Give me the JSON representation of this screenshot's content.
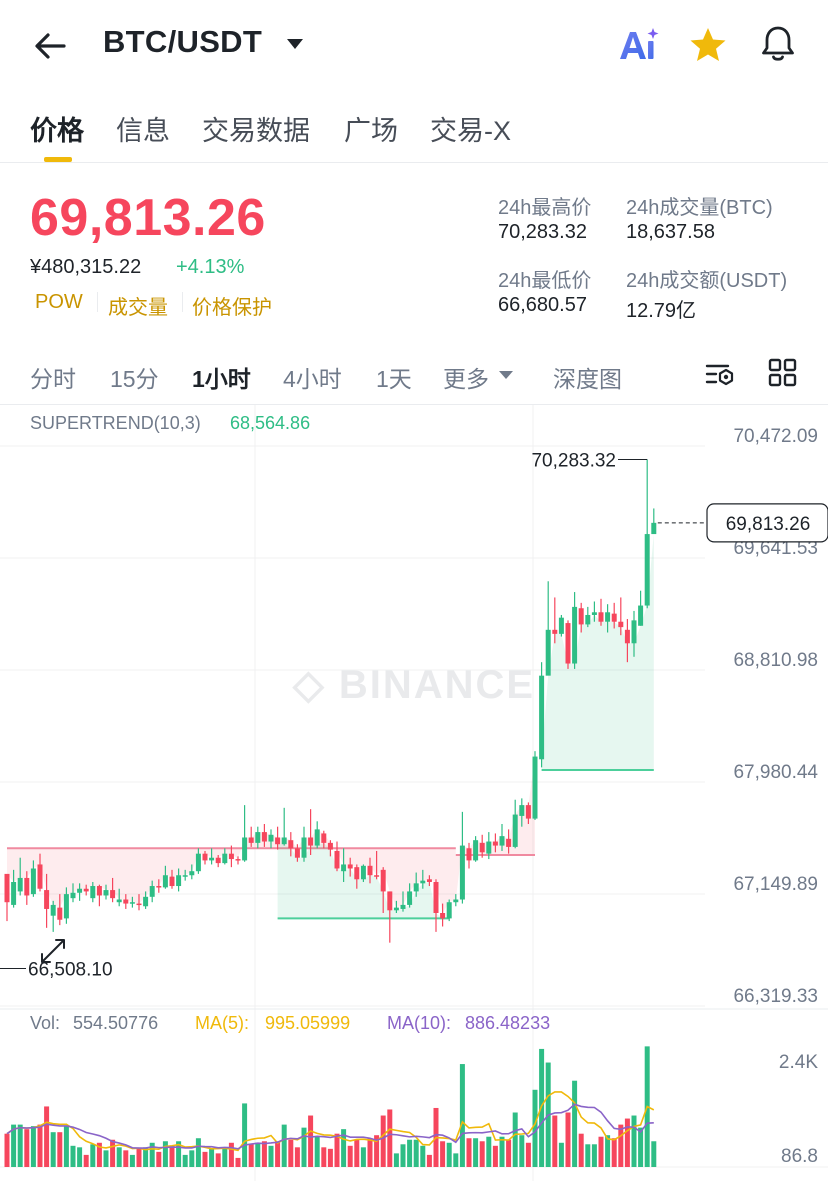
{
  "header": {
    "pair": "BTC/USDT",
    "icons": [
      "back-arrow-icon",
      "caret-down-icon",
      "ai-icon",
      "star-icon",
      "bell-icon"
    ]
  },
  "tabs": [
    "价格",
    "信息",
    "交易数据",
    "广场",
    "交易-X"
  ],
  "active_tab": "价格",
  "price": {
    "last": "69,813.26",
    "cny": "¥480,315.22",
    "change": "+4.13%",
    "tags": [
      "POW",
      "成交量",
      "价格保护"
    ]
  },
  "stats": {
    "high_label": "24h最高价",
    "high_value": "70,283.32",
    "vol_btc_label": "24h成交量(BTC)",
    "vol_btc_value": "18,637.58",
    "low_label": "24h最低价",
    "low_value": "66,680.57",
    "vol_usdt_label": "24h成交额(USDT)",
    "vol_usdt_value": "12.79亿"
  },
  "intervals": {
    "items": [
      "分时",
      "15分",
      "1小时",
      "4小时",
      "1天",
      "更多",
      "深度图"
    ],
    "active": "1小时"
  },
  "indicator": {
    "supertrend_label": "SUPERTREND(10,3)",
    "supertrend_value": "68,564.86"
  },
  "colors": {
    "up": "#2ebd85",
    "down": "#f6465d",
    "accent": "#f0b90b",
    "tag": "#c99400",
    "ma5": "#f0b90b",
    "ma10": "#8a64c8"
  },
  "chart_data": {
    "type": "candlestick",
    "watermark": "BINANCE",
    "y_ticks": [
      "70,472.09",
      "69,641.53",
      "68,810.98",
      "67,980.44",
      "67,149.89",
      "66,319.33"
    ],
    "ylim": [
      66319.33,
      70472.09
    ],
    "high_marker": "70,283.32",
    "low_marker": "66,508.10",
    "last_price_label": "69,813.26",
    "candles": [
      [
        67210,
        67000,
        66860,
        67080
      ],
      [
        66980,
        67150,
        66960,
        67240
      ],
      [
        67080,
        67180,
        67050,
        67330
      ],
      [
        67180,
        67050,
        66980,
        67230
      ],
      [
        67060,
        67250,
        67040,
        67310
      ],
      [
        67280,
        67100,
        67080,
        67360
      ],
      [
        67090,
        66950,
        66810,
        67210
      ],
      [
        66900,
        66980,
        66780,
        67010
      ],
      [
        66960,
        66870,
        66830,
        67060
      ],
      [
        66880,
        67060,
        66840,
        67110
      ],
      [
        67030,
        67070,
        67000,
        67140
      ],
      [
        67070,
        67100,
        67010,
        67140
      ],
      [
        67100,
        67080,
        67050,
        67130
      ],
      [
        67030,
        67120,
        67000,
        67150
      ],
      [
        67120,
        67050,
        66970,
        67130
      ],
      [
        67050,
        67090,
        67020,
        67130
      ],
      [
        67090,
        67030,
        67000,
        67180
      ],
      [
        67000,
        67020,
        66970,
        67100
      ],
      [
        67020,
        66990,
        66950,
        67060
      ],
      [
        66990,
        67000,
        66960,
        67040
      ],
      [
        66990,
        66980,
        66940,
        67060
      ],
      [
        66970,
        67040,
        66950,
        67080
      ],
      [
        67040,
        67120,
        67000,
        67160
      ],
      [
        67120,
        67110,
        67070,
        67170
      ],
      [
        67110,
        67200,
        67100,
        67270
      ],
      [
        67190,
        67120,
        67100,
        67240
      ],
      [
        67120,
        67200,
        67080,
        67250
      ],
      [
        67200,
        67200,
        67160,
        67240
      ],
      [
        67200,
        67230,
        67170,
        67280
      ],
      [
        67230,
        67360,
        67210,
        67400
      ],
      [
        67360,
        67310,
        67280,
        67380
      ],
      [
        67310,
        67330,
        67280,
        67400
      ],
      [
        67330,
        67290,
        67260,
        67350
      ],
      [
        67290,
        67360,
        67280,
        67400
      ],
      [
        67360,
        67320,
        67260,
        67420
      ],
      [
        67320,
        67310,
        67280,
        67340
      ],
      [
        67310,
        67480,
        67300,
        67720
      ],
      [
        67480,
        67440,
        67410,
        67560
      ],
      [
        67440,
        67520,
        67400,
        67560
      ],
      [
        67520,
        67450,
        67410,
        67580
      ],
      [
        67450,
        67500,
        67400,
        67540
      ],
      [
        67480,
        67430,
        67390,
        67560
      ],
      [
        67430,
        67480,
        67420,
        67700
      ],
      [
        67460,
        67400,
        67340,
        67520
      ],
      [
        67400,
        67330,
        67300,
        67430
      ],
      [
        67330,
        67480,
        67300,
        67560
      ],
      [
        67480,
        67420,
        67350,
        67690
      ],
      [
        67420,
        67540,
        67400,
        67600
      ],
      [
        67510,
        67440,
        67400,
        67530
      ],
      [
        67440,
        67390,
        67340,
        67460
      ],
      [
        67380,
        67250,
        67230,
        67450
      ],
      [
        67230,
        67280,
        67150,
        67400
      ],
      [
        67280,
        67250,
        67190,
        67330
      ],
      [
        67260,
        67170,
        67100,
        67280
      ],
      [
        67170,
        67270,
        67150,
        67280
      ],
      [
        67270,
        67200,
        67140,
        67330
      ],
      [
        67200,
        67190,
        67170,
        67380
      ],
      [
        67240,
        67080,
        66920,
        67260
      ],
      [
        67080,
        66940,
        66700,
        67080
      ],
      [
        66940,
        66960,
        66920,
        67010
      ],
      [
        66950,
        66980,
        66930,
        67080
      ],
      [
        66980,
        67080,
        66960,
        67140
      ],
      [
        67080,
        67140,
        67040,
        67220
      ],
      [
        67140,
        67160,
        67100,
        67240
      ],
      [
        67170,
        67150,
        67120,
        67200
      ],
      [
        67150,
        66920,
        66780,
        67170
      ],
      [
        66920,
        66880,
        66820,
        66990
      ],
      [
        66880,
        67000,
        66860,
        67020
      ],
      [
        67000,
        67020,
        66970,
        67060
      ],
      [
        67020,
        67420,
        66990,
        67670
      ],
      [
        67400,
        67310,
        67250,
        67440
      ],
      [
        67310,
        67460,
        67300,
        67490
      ],
      [
        67440,
        67370,
        67330,
        67500
      ],
      [
        67360,
        67450,
        67320,
        67520
      ],
      [
        67450,
        67420,
        67370,
        67510
      ],
      [
        67420,
        67490,
        67380,
        67580
      ],
      [
        67470,
        67410,
        67360,
        67540
      ],
      [
        67410,
        67650,
        67400,
        67760
      ],
      [
        67640,
        67720,
        67560,
        67770
      ],
      [
        67720,
        67620,
        67580,
        67740
      ],
      [
        67620,
        68080,
        67610,
        68120
      ],
      [
        68060,
        68680,
        68000,
        68780
      ],
      [
        68680,
        69020,
        68690,
        69380
      ],
      [
        69020,
        68990,
        68920,
        69260
      ],
      [
        68990,
        69110,
        68970,
        69130
      ],
      [
        69070,
        68770,
        68730,
        69090
      ],
      [
        68770,
        69190,
        68730,
        69300
      ],
      [
        69180,
        69060,
        69000,
        69220
      ],
      [
        69060,
        69130,
        69040,
        69190
      ],
      [
        69130,
        69150,
        69080,
        69230
      ],
      [
        69150,
        69080,
        69050,
        69250
      ],
      [
        69080,
        69150,
        69000,
        69210
      ],
      [
        69140,
        69080,
        69030,
        69220
      ],
      [
        69080,
        69040,
        68980,
        69260
      ],
      [
        69020,
        68920,
        68780,
        69100
      ],
      [
        68920,
        69090,
        68820,
        69160
      ],
      [
        69050,
        69200,
        69050,
        69310
      ],
      [
        69200,
        69730,
        69180,
        70283.32
      ],
      [
        69730,
        69813.26,
        69750,
        69920
      ]
    ],
    "supertrend_resistance": [
      {
        "from": 0,
        "to": 68,
        "value": 67400
      },
      {
        "from": 68,
        "to": 80,
        "value": 67350
      }
    ],
    "supertrend_support": [
      {
        "from": 41,
        "to": 67,
        "value": 66880
      },
      {
        "from": 81,
        "to": 98,
        "value": 67980
      }
    ],
    "volume_legend": {
      "vol_label": "Vol:",
      "vol_value": "554.50776",
      "ma5_label": "MA(5):",
      "ma5_value": "995.05999",
      "ma10_label": "MA(10):",
      "ma10_value": "886.48233"
    },
    "volume_ticks": [
      "2.4K",
      "86.8"
    ],
    "volume_ylim": [
      0,
      2600
    ]
  }
}
